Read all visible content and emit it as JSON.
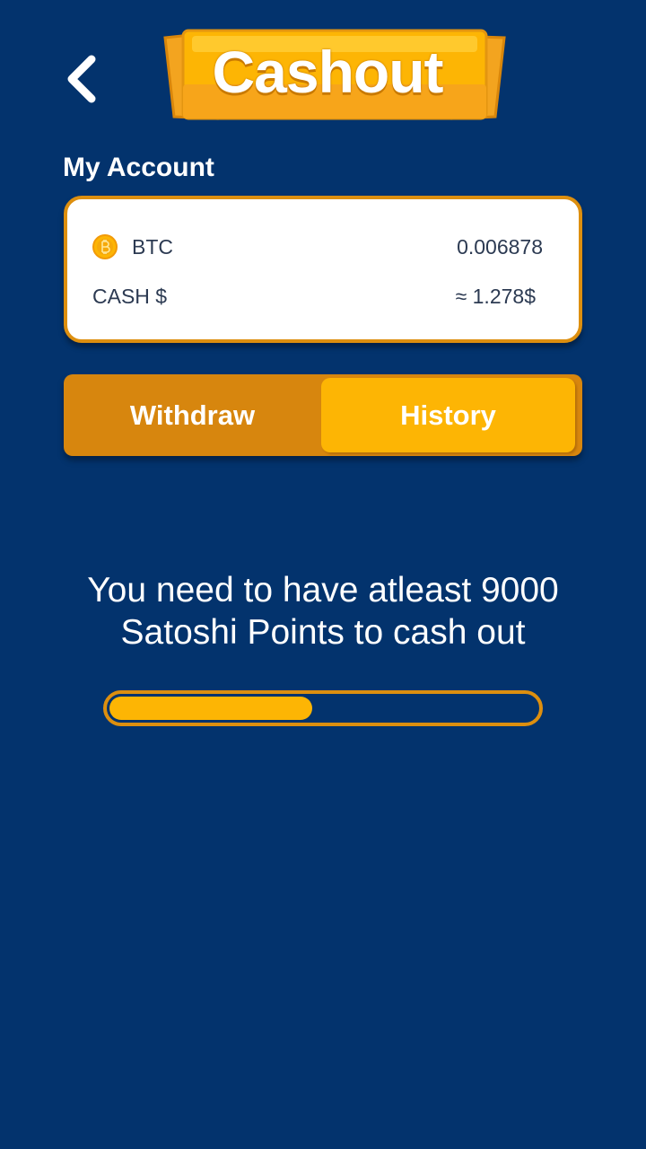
{
  "header": {
    "title": "Cashout",
    "back_icon": "chevron-left-icon"
  },
  "account": {
    "section_label": "My Account",
    "rows": [
      {
        "icon": "bitcoin-coin-icon",
        "label": "BTC",
        "value": "0.006878"
      },
      {
        "label": "CASH $",
        "value": "≈ 1.278$"
      }
    ]
  },
  "tabs": [
    {
      "label": "Withdraw",
      "selected": false
    },
    {
      "label": "History",
      "selected": true
    }
  ],
  "message": {
    "line1": "You need to have atleast 9000",
    "line2": "Satoshi Points to cash out"
  },
  "progress": {
    "fraction": 0.475
  },
  "colors": {
    "background": "#03336d",
    "accent_orange": "#d7860e",
    "accent_yellow": "#fdb504",
    "card_border": "#dd8f0f"
  }
}
